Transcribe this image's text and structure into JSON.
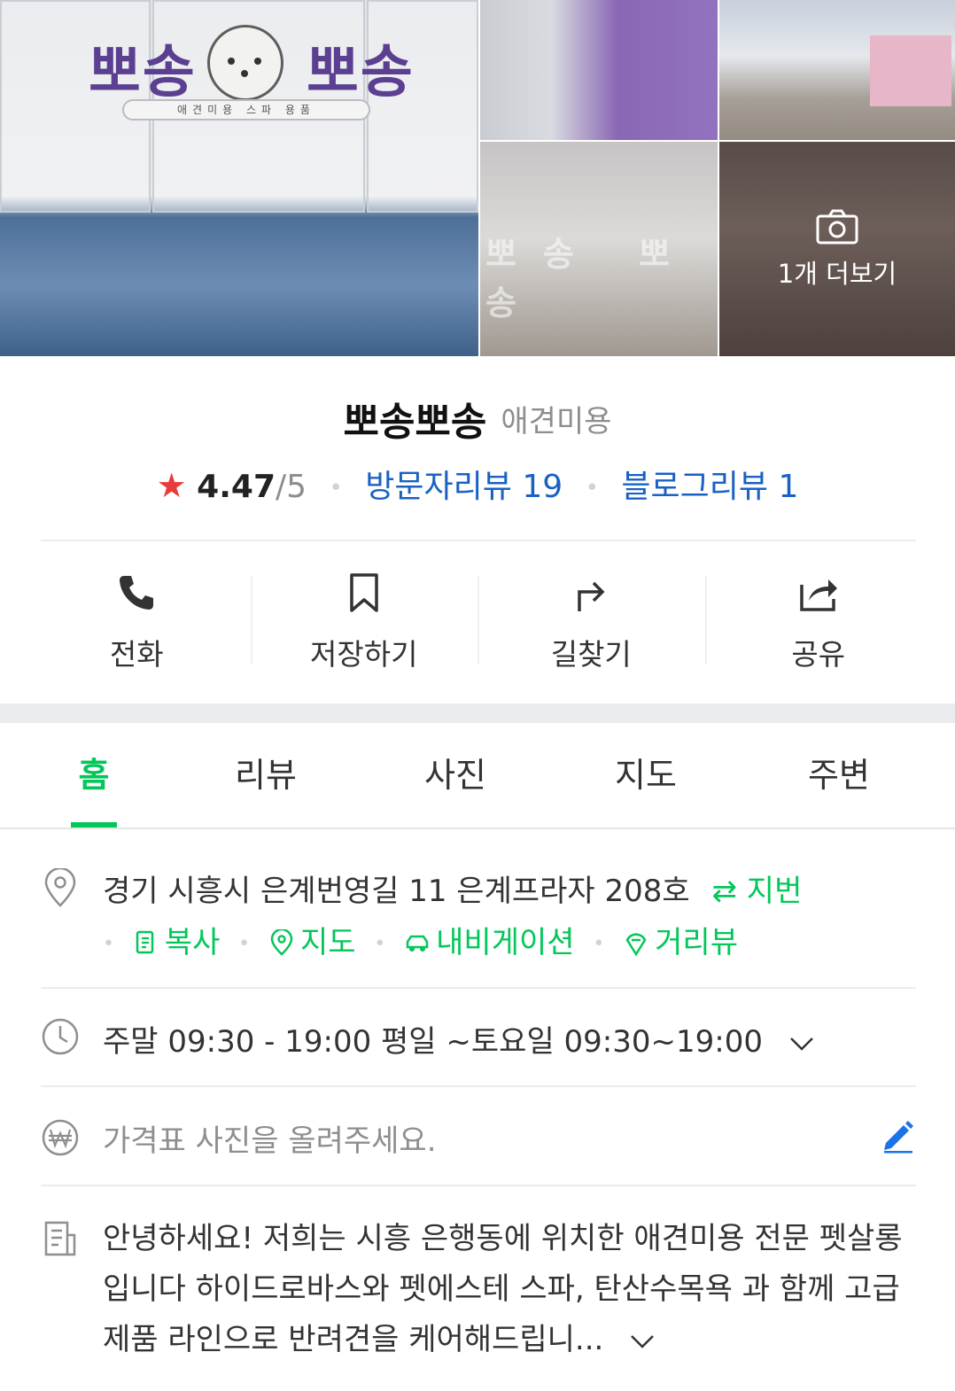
{
  "photos": {
    "main_sign": {
      "left_word": "뽀송",
      "right_word": "뽀송",
      "bar_text": "애견미용  스파  용품"
    },
    "more_label": "1개 더보기"
  },
  "place": {
    "name": "뽀송뽀송",
    "category": "애견미용",
    "rating": "4.47",
    "rating_max": "/5",
    "visitor_reviews": "방문자리뷰 19",
    "blog_reviews": "블로그리뷰 1"
  },
  "actions": [
    {
      "label": "전화",
      "icon": "phone-icon"
    },
    {
      "label": "저장하기",
      "icon": "bookmark-icon"
    },
    {
      "label": "길찾기",
      "icon": "directions-icon"
    },
    {
      "label": "공유",
      "icon": "share-icon"
    }
  ],
  "tabs": [
    "홈",
    "리뷰",
    "사진",
    "지도",
    "주변"
  ],
  "active_tab": "홈",
  "address": {
    "text": "경기 시흥시 은계번영길 11 은계프라자 208호",
    "toggle": "⇄ 지번",
    "links": [
      "복사",
      "지도",
      "내비게이션",
      "거리뷰"
    ]
  },
  "hours": {
    "text": "주말 09:30 - 19:00 평일 ~토요일 09:30~19:00"
  },
  "price": {
    "placeholder": "가격표 사진을 올려주세요."
  },
  "description": {
    "text": "안녕하세요! 저희는 시흥 은행동에 위치한 애견미용 전문 펫살롱입니다 하이드로바스와 펫에스테 스파, 탄산수목욕 과 함께 고급 제품 라인으로 반려견을 케어해드립니..."
  },
  "colors": {
    "accent": "#03c75a",
    "link": "#1a61c3",
    "star": "#e83b3b",
    "edit": "#1a73e8"
  }
}
